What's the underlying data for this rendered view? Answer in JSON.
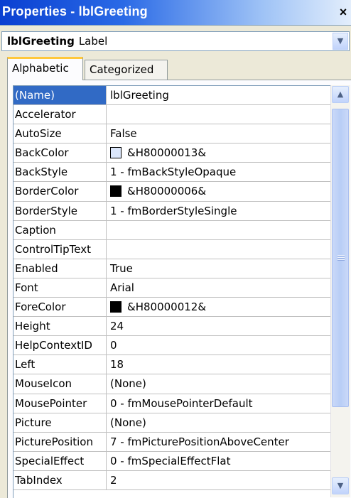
{
  "window": {
    "title": "Properties - lblGreeting",
    "close_label": "×"
  },
  "object_box": {
    "name": "lblGreeting",
    "type": "Label",
    "dropdown_icon": "chevron-down-icon"
  },
  "tabs": [
    {
      "label": "Alphabetic",
      "active": true
    },
    {
      "label": "Categorized",
      "active": false
    }
  ],
  "properties": [
    {
      "name": "(Name)",
      "value": "lblGreeting",
      "selected": true
    },
    {
      "name": "Accelerator",
      "value": ""
    },
    {
      "name": "AutoSize",
      "value": "False"
    },
    {
      "name": "BackColor",
      "value": "&H80000013&",
      "swatch": "#dbe6fa"
    },
    {
      "name": "BackStyle",
      "value": "1 - fmBackStyleOpaque"
    },
    {
      "name": "BorderColor",
      "value": "&H80000006&",
      "swatch": "#000000"
    },
    {
      "name": "BorderStyle",
      "value": "1 - fmBorderStyleSingle"
    },
    {
      "name": "Caption",
      "value": ""
    },
    {
      "name": "ControlTipText",
      "value": ""
    },
    {
      "name": "Enabled",
      "value": "True"
    },
    {
      "name": "Font",
      "value": "Arial"
    },
    {
      "name": "ForeColor",
      "value": "&H80000012&",
      "swatch": "#000000"
    },
    {
      "name": "Height",
      "value": "24"
    },
    {
      "name": "HelpContextID",
      "value": "0"
    },
    {
      "name": "Left",
      "value": "18"
    },
    {
      "name": "MouseIcon",
      "value": "(None)"
    },
    {
      "name": "MousePointer",
      "value": "0 - fmMousePointerDefault"
    },
    {
      "name": "Picture",
      "value": "(None)"
    },
    {
      "name": "PicturePosition",
      "value": "7 - fmPicturePositionAboveCenter"
    },
    {
      "name": "SpecialEffect",
      "value": "0 - fmSpecialEffectFlat"
    },
    {
      "name": "TabIndex",
      "value": "2"
    }
  ],
  "colors": {
    "selection": "#316ac5",
    "title_start": "#0a3fd1",
    "tab_highlight": "#ffc83c"
  }
}
